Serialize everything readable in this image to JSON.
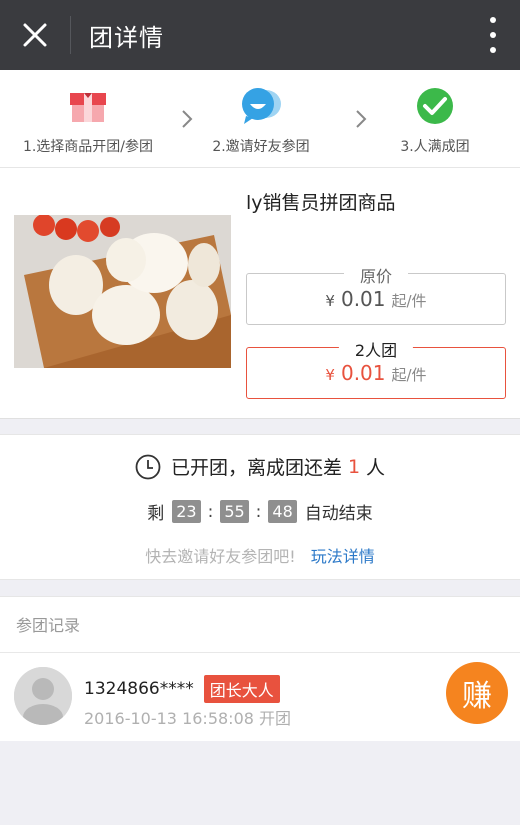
{
  "header": {
    "title": "团详情"
  },
  "steps": [
    {
      "label": "1.选择商品开团/参团",
      "icon": "gift-box-icon"
    },
    {
      "label": "2.邀请好友参团",
      "icon": "chat-bubble-icon"
    },
    {
      "label": "3.人满成团",
      "icon": "check-circle-icon"
    }
  ],
  "product": {
    "name": "ly销售员拼团商品",
    "original": {
      "label": "原价",
      "currency": "¥",
      "price": "0.01",
      "unit": "起/件"
    },
    "group": {
      "label": "2人团",
      "currency": "¥",
      "price": "0.01",
      "unit": "起/件"
    }
  },
  "status": {
    "prefix": "已开团，离成团还差",
    "remaining": "1",
    "suffix": "人",
    "countdown_prefix": "剩",
    "hours": "23",
    "minutes": "55",
    "seconds": "48",
    "countdown_suffix": "自动结束",
    "invite_text": "快去邀请好友参团吧!",
    "rules_link": "玩法详情"
  },
  "records": {
    "title": "参团记录",
    "items": [
      {
        "user": "1324866****",
        "badge": "团长大人",
        "time": "2016-10-13 16:58:08 开团"
      }
    ]
  },
  "earn_button": "赚",
  "colors": {
    "accent": "#e8523e",
    "earn": "#f5841f",
    "link": "#2c79c8",
    "topbar": "#3a3b3f"
  }
}
